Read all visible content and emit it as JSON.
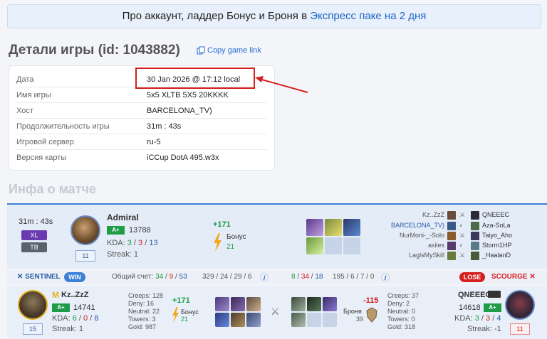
{
  "promo": {
    "text": "Про аккаунт, ладдер Бонус и Броня в ",
    "link": "Экспресс паке на 2 дня"
  },
  "page": {
    "title": "Детали игры (id: 1043882)",
    "copy_link": "Copy game link"
  },
  "details": [
    {
      "k": "Дата",
      "v": "30 Jan 2026 @ 17:12 local"
    },
    {
      "k": "Имя игры",
      "v": "5x5 XLTB 5X5 20KKKK"
    },
    {
      "k": "Хост",
      "v": "BARCELONA_TV)"
    },
    {
      "k": "Продолжительность игры",
      "v": "31m : 43s"
    },
    {
      "k": "Игровой сервер",
      "v": "ru-5"
    },
    {
      "k": "Версия карты",
      "v": "iCCup DotA 495.w3x"
    }
  ],
  "section2": "Инфа о матче",
  "match": {
    "duration": "31m : 43s",
    "mode1": "XL",
    "mode2": "TB",
    "player": "Admiral",
    "rank": "A+",
    "rating": "13788",
    "kda_label": "KDA:",
    "kda_k": "3",
    "kda_d": "3",
    "kda_a": "13",
    "streak": "Streak: 1",
    "level": "11",
    "delta": "+171",
    "bonus_label": "Бонус",
    "bonus_val": "21",
    "sentinel_names": [
      "Kz..ZzZ",
      "BARCELONA_TV)",
      "NurMoni-_-Solo",
      "axiles",
      "LaglsMySkill"
    ],
    "scourge_names": [
      "QNEEEC",
      "Aza-SoLa",
      "Taiyo_Aho",
      "Storm1HP",
      "_HaalanD"
    ]
  },
  "scorebar": {
    "sentinel": "SENTINEL",
    "win": "WIN",
    "total_label": "Общий счет:",
    "t1": "34",
    "t2": "9",
    "t3": "53",
    "s_stats": "329 / 24 / 29 / 6",
    "info": "i",
    "r1": "8",
    "r2": "34",
    "r3": "18",
    "r_stats": "195 / 6 / 7 / 0",
    "lose": "LOSE",
    "scourge": "SCOURGE"
  },
  "left_player": {
    "name": "Kz..ZzZ",
    "rank": "A+",
    "rating": "14741",
    "kda_label": "KDA:",
    "k": "6",
    "d": "0",
    "a": "8",
    "streak": "Streak: 1",
    "level": "15",
    "creeps": "Creeps: 128",
    "deny": "Deny: 16",
    "neutral": "Neutral: 22",
    "towers": "Towers: 3",
    "gold": "Gold: 987",
    "delta": "+171",
    "bonus_label": "Бонус",
    "bonus_val": "21"
  },
  "right_player": {
    "name": "QNEEEC",
    "rank": "A+",
    "rating": "14618",
    "kda_label": "KDA:",
    "k": "3",
    "d": "3",
    "a": "4",
    "streak": "Streak: -1",
    "level": "11",
    "creeps": "Creeps: 37",
    "deny": "Deny: 2",
    "neutral": "Neutral: 0",
    "towers": "Towers: 0",
    "gold": "Gold: 318",
    "delta": "-115",
    "armor_label": "Броня",
    "armor_val": "39"
  },
  "colors": {
    "accent": "#3d7fd8",
    "win": "#1e9c48",
    "lose": "#d42020",
    "annotation": "#d42020"
  }
}
